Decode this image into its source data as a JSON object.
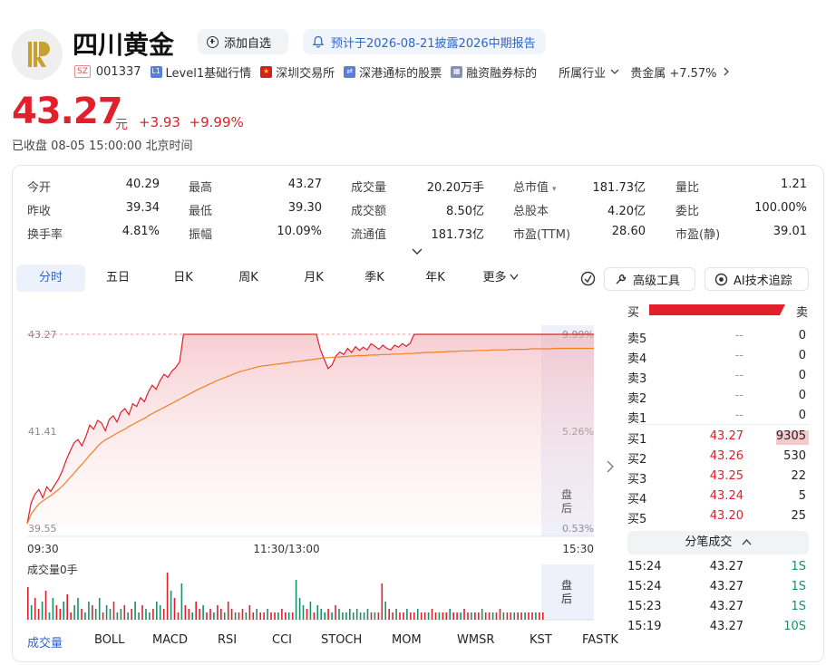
{
  "header": {
    "name": "四川黄金",
    "add_watch": "添加自选",
    "notice": "预计于2026-08-21披露2026中期报告",
    "market": "SZ",
    "code": "001337",
    "tags": [
      "Level1基础行情",
      "深圳交易所",
      "深港通标的股票",
      "融资融券标的"
    ],
    "industry_label": "所属行业",
    "industry": "贵金属 +7.57%"
  },
  "price": {
    "last": "43.27",
    "unit": "元",
    "change": "+3.93",
    "pct": "+9.99%",
    "status": "已收盘  08-05 15:00:00 北京时间"
  },
  "quote": [
    [
      [
        "今开",
        "40.29",
        "red"
      ],
      [
        "最高",
        "43.27",
        "red"
      ],
      [
        "成交量",
        "20.20万手",
        ""
      ],
      [
        "总市值",
        "181.73亿",
        ""
      ],
      [
        "量比",
        "1.21",
        "red"
      ]
    ],
    [
      [
        "昨收",
        "39.34",
        ""
      ],
      [
        "最低",
        "39.30",
        "green"
      ],
      [
        "成交额",
        "8.50亿",
        ""
      ],
      [
        "总股本",
        "4.20亿",
        ""
      ],
      [
        "委比",
        "100.00%",
        ""
      ]
    ],
    [
      [
        "换手率",
        "4.81%",
        ""
      ],
      [
        "振幅",
        "10.09%",
        ""
      ],
      [
        "流通值",
        "181.73亿",
        ""
      ],
      [
        "市盈(TTM)",
        "28.60",
        ""
      ],
      [
        "市盈(静)",
        "39.01",
        ""
      ]
    ]
  ],
  "period_tabs": [
    "分时",
    "五日",
    "日K",
    "周K",
    "月K",
    "季K",
    "年K",
    "更多"
  ],
  "tools": {
    "advanced": "高级工具",
    "ai": "AI技术追踪"
  },
  "chart_data": {
    "type": "line",
    "y_left": [
      "43.27",
      "41.41",
      "39.55"
    ],
    "y_right": [
      "9.99%",
      "5.26%",
      "0.53%"
    ],
    "x_ticks": [
      "09:30",
      "11:30/13:00",
      "15:30"
    ],
    "ylim": [
      39.55,
      43.27
    ],
    "after_hours": "盘后",
    "volume_label": "成交量0手",
    "colors": {
      "up": "#e0202a",
      "down": "#1a8f6a",
      "avg": "#ef8020"
    },
    "price_series": [
      39.62,
      40.02,
      40.19,
      40.28,
      40.12,
      40.33,
      40.24,
      40.36,
      40.48,
      40.64,
      40.85,
      41.02,
      41.18,
      41.24,
      41.12,
      41.3,
      41.52,
      41.44,
      41.61,
      41.56,
      41.41,
      41.63,
      41.7,
      41.58,
      41.77,
      41.84,
      41.72,
      41.93,
      41.88,
      42.05,
      41.97,
      42.16,
      42.29,
      42.21,
      42.38,
      42.5,
      42.44,
      42.56,
      42.63,
      42.74,
      43.27,
      43.27,
      43.27,
      43.27,
      43.27,
      43.27,
      43.27,
      43.27,
      43.27,
      43.27,
      43.27,
      43.27,
      43.27,
      43.27,
      43.27,
      43.27,
      43.27,
      43.27,
      43.27,
      43.27,
      43.27,
      43.27,
      43.27,
      43.27,
      43.27,
      43.27,
      43.27,
      43.27,
      43.27,
      43.27,
      43.27,
      43.27,
      43.27,
      43.27,
      43.27,
      42.98,
      42.79,
      42.61,
      42.68,
      42.85,
      42.93,
      42.88,
      43.0,
      42.92,
      43.03,
      42.96,
      43.02,
      42.97,
      43.09,
      43.04,
      42.98,
      43.06,
      43.0,
      42.97,
      43.06,
      43.02,
      43.09,
      43.04,
      43.1,
      43.27,
      43.27,
      43.27,
      43.27,
      43.27,
      43.27,
      43.27,
      43.27,
      43.27,
      43.27,
      43.27,
      43.27,
      43.27,
      43.27,
      43.27,
      43.27,
      43.27,
      43.27,
      43.27,
      43.27,
      43.27,
      43.27,
      43.27,
      43.27,
      43.27,
      43.27,
      43.27,
      43.27,
      43.27,
      43.27,
      43.27,
      43.27,
      43.27,
      43.27,
      43.27,
      43.27,
      43.27,
      43.27,
      43.27,
      43.27,
      43.27,
      43.27,
      43.27,
      43.27,
      43.27,
      43.27,
      43.27
    ],
    "avg_series": [
      39.62,
      39.8,
      39.91,
      40.0,
      40.06,
      40.11,
      40.16,
      40.22,
      40.28,
      40.35,
      40.43,
      40.52,
      40.6,
      40.69,
      40.77,
      40.86,
      40.95,
      41.03,
      41.12,
      41.19,
      41.24,
      41.28,
      41.33,
      41.37,
      41.41,
      41.45,
      41.5,
      41.54,
      41.58,
      41.62,
      41.66,
      41.71,
      41.75,
      41.79,
      41.83,
      41.87,
      41.91,
      41.95,
      41.99,
      42.03,
      42.07,
      42.11,
      42.15,
      42.19,
      42.23,
      42.26,
      42.3,
      42.33,
      42.37,
      42.4,
      42.43,
      42.46,
      42.49,
      42.52,
      42.55,
      42.57,
      42.59,
      42.61,
      42.63,
      42.65,
      42.66,
      42.67,
      42.68,
      42.69,
      42.7,
      42.71,
      42.72,
      42.73,
      42.74,
      42.75,
      42.76,
      42.77,
      42.78,
      42.79,
      42.8,
      42.81,
      42.82,
      42.82,
      42.83,
      42.83,
      42.84,
      42.84,
      42.85,
      42.85,
      42.86,
      42.86,
      42.86,
      42.87,
      42.87,
      42.87,
      42.88,
      42.88,
      42.88,
      42.89,
      42.89,
      42.89,
      42.9,
      42.9,
      42.9,
      42.91,
      42.91,
      42.92,
      42.92,
      42.92,
      42.93,
      42.93,
      42.93,
      42.94,
      42.94,
      42.94,
      42.95,
      42.95,
      42.95,
      42.95,
      42.96,
      42.96,
      42.96,
      42.96,
      42.97,
      42.97,
      42.97,
      42.97,
      42.97,
      42.98,
      42.98,
      42.98,
      42.98,
      42.98,
      42.99,
      42.99,
      42.99,
      42.99,
      42.99,
      42.99,
      43.0,
      43.0,
      43.0,
      43.0,
      43.0,
      43.0,
      43.0,
      43.0,
      43.0,
      43.0,
      43.0
    ],
    "volume_series": [
      9,
      4,
      6,
      3,
      5,
      8,
      2,
      6,
      4,
      3,
      5,
      7,
      2,
      4,
      6,
      3,
      2,
      5,
      4,
      3,
      6,
      2,
      4,
      3,
      5,
      2,
      3,
      4,
      2,
      3,
      5,
      2,
      4,
      3,
      2,
      3,
      5,
      4,
      3,
      13,
      8,
      6,
      2,
      10,
      4,
      3,
      2,
      5,
      3,
      4,
      2,
      3,
      2,
      4,
      3,
      2,
      5,
      3,
      2,
      2,
      3,
      2,
      4,
      2,
      3,
      2,
      2,
      3,
      2,
      2,
      2,
      3,
      2,
      2,
      2,
      11,
      6,
      4,
      3,
      5,
      2,
      4,
      3,
      2,
      3,
      2,
      4,
      3,
      2,
      2,
      3,
      2,
      3,
      2,
      2,
      3,
      2,
      2,
      2,
      10,
      5,
      3,
      2,
      3,
      2,
      2,
      3,
      2,
      2,
      3,
      2,
      2,
      2,
      3,
      2,
      2,
      2,
      2,
      3,
      2,
      2,
      2,
      3,
      2,
      2,
      2,
      2,
      3,
      2,
      2,
      2,
      2,
      3,
      2,
      2,
      2,
      2,
      2,
      2,
      2,
      2,
      2,
      2,
      2,
      2
    ]
  },
  "orderbook": {
    "buy_label": "买",
    "sell_label": "卖",
    "asks": [
      [
        "卖5",
        "--",
        "0"
      ],
      [
        "卖4",
        "--",
        "0"
      ],
      [
        "卖3",
        "--",
        "0"
      ],
      [
        "卖2",
        "--",
        "0"
      ],
      [
        "卖1",
        "--",
        "0"
      ]
    ],
    "bids": [
      [
        "买1",
        "43.27",
        "9305"
      ],
      [
        "买2",
        "43.26",
        "530"
      ],
      [
        "买3",
        "43.25",
        "22"
      ],
      [
        "买4",
        "43.24",
        "5"
      ],
      [
        "买5",
        "43.20",
        "25"
      ]
    ],
    "bid_vol_fraction": 1.0
  },
  "ticks": {
    "header": "分笔成交",
    "rows": [
      [
        "15:24",
        "43.27",
        "1S"
      ],
      [
        "15:24",
        "43.27",
        "1S"
      ],
      [
        "15:23",
        "43.27",
        "1S"
      ],
      [
        "15:19",
        "43.27",
        "10S"
      ]
    ]
  },
  "indicators": [
    "成交量",
    "BOLL",
    "MACD",
    "RSI",
    "CCI",
    "STOCH",
    "MOM",
    "WMSR",
    "KST",
    "FASTK"
  ]
}
